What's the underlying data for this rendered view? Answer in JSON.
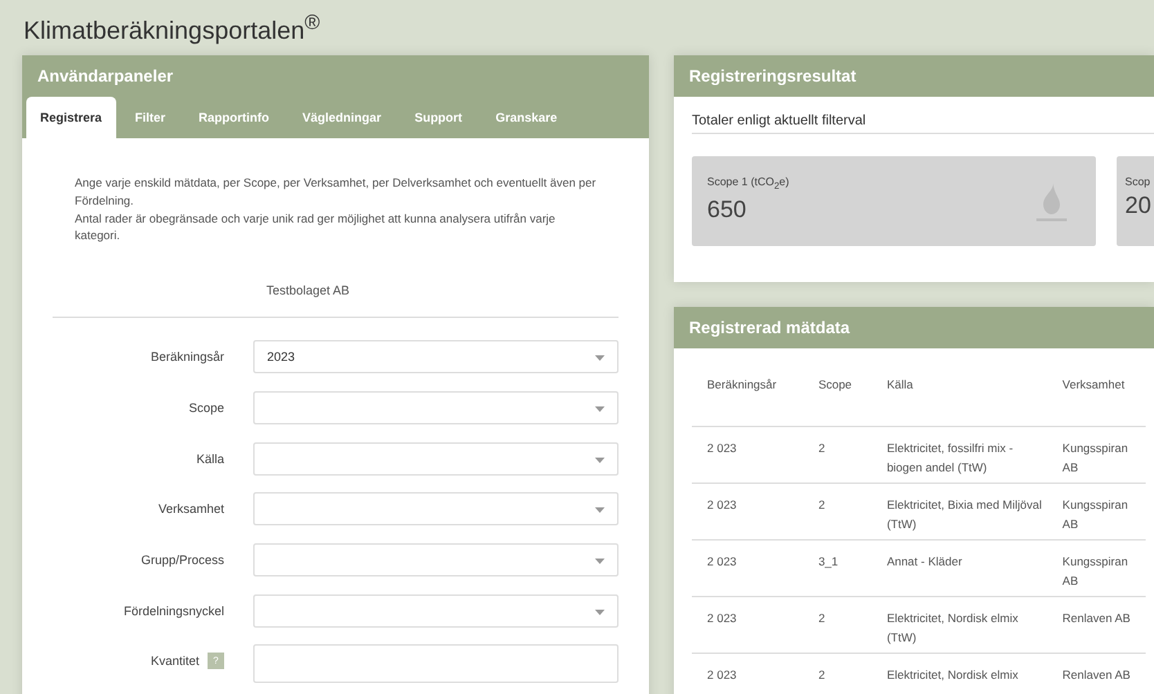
{
  "page_title": "Klimatberäkningsportalen$^{®}$",
  "user_panel": {
    "title": "Användarpaneler",
    "tabs": [
      {
        "label": "Registrera",
        "selected": true
      },
      {
        "label": "Filter",
        "selected": false
      },
      {
        "label": "Rapportinfo",
        "selected": false
      },
      {
        "label": "Vägledningar",
        "selected": false
      },
      {
        "label": "Support",
        "selected": false
      },
      {
        "label": "Granskare",
        "selected": false
      }
    ],
    "intro": [
      "Ange varje enskild mätdata, per Scope, per Verksamhet, per Delverksamhet och eventuellt även per Fördelning.",
      "Antal rader är obegränsade och varje unik rad ger möjlighet att kunna analysera utifrån varje kategori."
    ],
    "company": "Testbolaget AB",
    "fields": [
      {
        "label": "Beräkningsår",
        "kind": "select",
        "value": "2023"
      },
      {
        "label": "Scope",
        "kind": "select"
      },
      {
        "label": "Källa",
        "kind": "select"
      },
      {
        "label": "Verksamhet",
        "kind": "select"
      },
      {
        "label": "Grupp/Process",
        "kind": "select"
      },
      {
        "label": "Fördelningsnyckel",
        "kind": "select"
      },
      {
        "label": "Kvantitet",
        "kind": "input",
        "help": "?"
      }
    ]
  },
  "results": {
    "title": "Registreringsresultat",
    "subtitle": "Totaler enligt aktuellt filterval",
    "tiles": [
      {
        "label": "Scope 1 (tCO$_{2}$e)",
        "value": "650"
      },
      {
        "label": "Scop",
        "value": "20"
      }
    ]
  },
  "measurements": {
    "title": "Registrerad mätdata",
    "columns": [
      "Beräkningsår",
      "Scope",
      "Källa",
      "Verksamhet"
    ],
    "rows": [
      [
        "2 023",
        "2",
        "Elektricitet, fossilfri mix - biogen andel (TtW)",
        "Kungsspiran AB"
      ],
      [
        "2 023",
        "2",
        "Elektricitet, Bixia med Miljöval (TtW)",
        "Kungsspiran AB"
      ],
      [
        "2 023",
        "3_1",
        "Annat - Kläder",
        "Kungsspiran AB"
      ],
      [
        "2 023",
        "2",
        "Elektricitet, Nordisk elmix (TtW)",
        "Renlaven AB"
      ],
      [
        "2 023",
        "2",
        "Elektricitet, Nordisk elmix",
        "Renlaven AB"
      ]
    ]
  }
}
